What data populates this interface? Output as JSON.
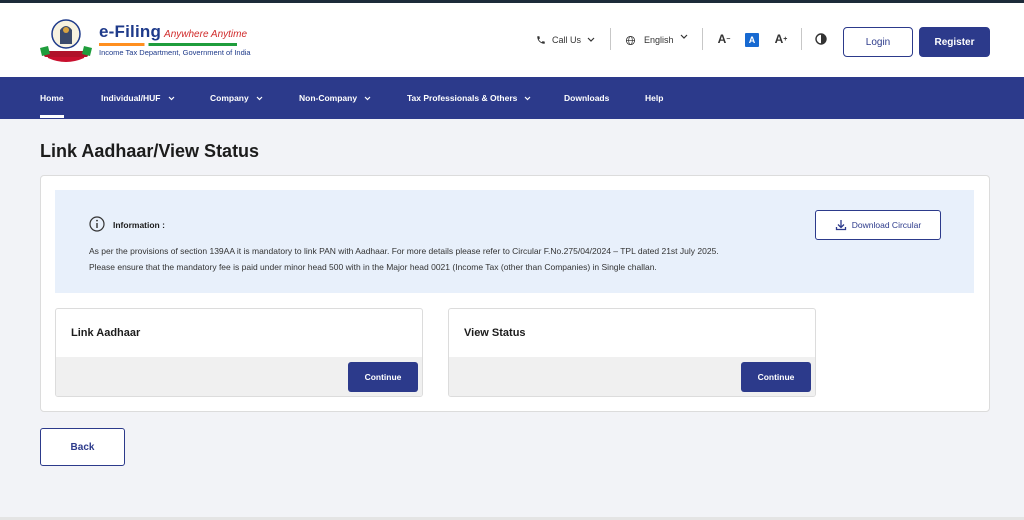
{
  "header": {
    "logo": {
      "title": "e-Filing",
      "tagline": "Anywhere Anytime",
      "subtitle": "Income Tax Department, Government of India",
      "emblem_icon": "national-emblem-icon"
    },
    "call_us": {
      "label": "Call Us",
      "icon": "phone-icon"
    },
    "language": {
      "label": "English",
      "icon": "globe-icon"
    },
    "font_size": {
      "decrease": "A",
      "normal": "A",
      "increase": "A"
    },
    "contrast_icon": "contrast-icon",
    "login_label": "Login",
    "register_label": "Register"
  },
  "nav": {
    "items": [
      {
        "label": "Home",
        "active": true,
        "dropdown": false
      },
      {
        "label": "Individual/HUF",
        "dropdown": true
      },
      {
        "label": "Company",
        "dropdown": true
      },
      {
        "label": "Non-Company",
        "dropdown": true
      },
      {
        "label": "Tax Professionals & Others",
        "dropdown": true
      },
      {
        "label": "Downloads",
        "dropdown": false
      },
      {
        "label": "Help",
        "dropdown": false
      }
    ]
  },
  "page": {
    "title": "Link Aadhaar/View Status",
    "info": {
      "label": "Information :",
      "line1": "As per the provisions of section 139AA it is mandatory to link PAN with Aadhaar. For more details please refer to Circular F.No.275/04/2024 – TPL dated 21st July 2025.",
      "line2": "Please ensure that the mandatory fee is paid under minor head 500 with in the Major head 0021 (Income Tax (other than Companies) in Single challan."
    },
    "download_label": "Download Circular",
    "cards": [
      {
        "title": "Link Aadhaar",
        "button": "Continue"
      },
      {
        "title": "View Status",
        "button": "Continue"
      }
    ],
    "back_label": "Back"
  },
  "colors": {
    "primary": "#2c3a8b",
    "info_bg": "#e8f0fb",
    "page_bg": "#f2f3f7",
    "tagline": "#d02a2a",
    "active_font": "#1769d1"
  }
}
